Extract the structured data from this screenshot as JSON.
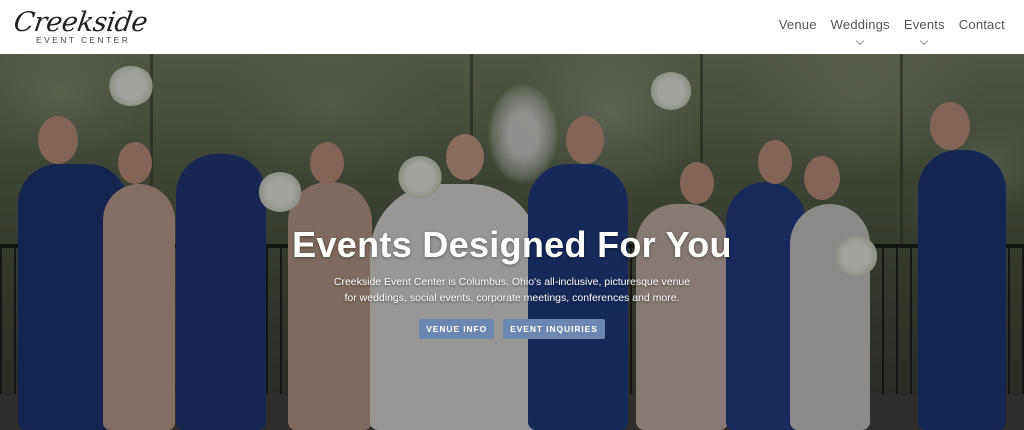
{
  "logo": {
    "script": "Creekside",
    "sub": "EVENT CENTER"
  },
  "nav": {
    "items": [
      {
        "label": "Venue",
        "has_dropdown": false
      },
      {
        "label": "Weddings",
        "has_dropdown": true
      },
      {
        "label": "Events",
        "has_dropdown": true
      },
      {
        "label": "Contact",
        "has_dropdown": false
      }
    ]
  },
  "hero": {
    "title": "Events Designed For You",
    "description": "Creekside Event Center is Columbus, Ohio's all-inclusive, picturesque venue for weddings, social events, corporate meetings, conferences and more.",
    "buttons": {
      "venue_info": "VENUE INFO",
      "event_inquiries": "EVENT INQUIRIES"
    }
  },
  "colors": {
    "button": "#6c88b0",
    "nav_text": "#555555",
    "chevron": "#8a95a5"
  }
}
